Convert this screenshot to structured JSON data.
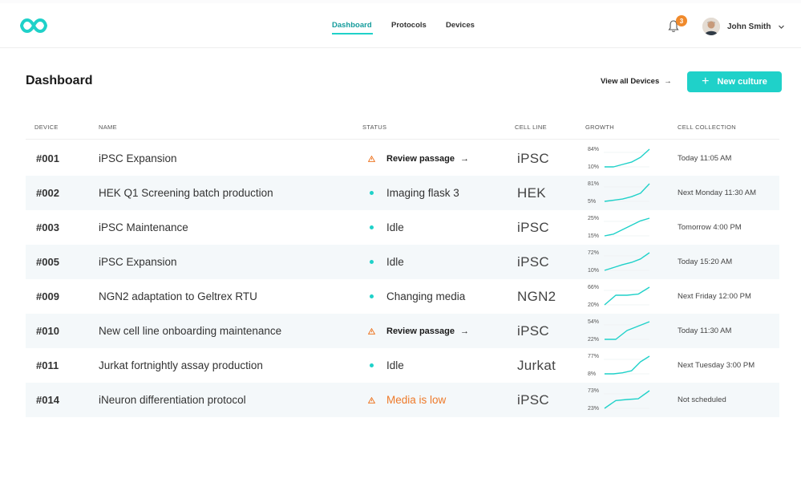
{
  "nav": {
    "items": [
      {
        "label": "Dashboard",
        "active": true
      },
      {
        "label": "Protocols",
        "active": false
      },
      {
        "label": "Devices",
        "active": false
      }
    ]
  },
  "notifications": {
    "count": "3",
    "icon": "bell-icon"
  },
  "user": {
    "name": "John Smith",
    "avatar": "avatar"
  },
  "header": {
    "title": "Dashboard",
    "view_all_label": "View all Devices",
    "view_all_arrow": "→",
    "new_culture_label": "New culture",
    "new_culture_icon": "+"
  },
  "colors": {
    "accent": "#1fd1c9",
    "accent_text": "#159c9c",
    "warning": "#ee7a2a",
    "badge": "#f08a2c",
    "row_alt": "#f4f8fa"
  },
  "table": {
    "columns": [
      "DEVICE",
      "NAME",
      "STATUS",
      "CELL LINE",
      "GROWTH",
      "CELL COLLECTION"
    ],
    "rows": [
      {
        "device": "#001",
        "name": "iPSC Expansion",
        "status": "Review passage",
        "status_type": "warning-action",
        "status_arrow": "→",
        "cell_line": "iPSC",
        "growth_high": "84%",
        "growth_low": "10%",
        "growth_series": [
          10,
          10,
          20,
          30,
          50,
          84
        ],
        "collection": "Today 11:05 AM"
      },
      {
        "device": "#002",
        "name": "HEK Q1 Screening batch production",
        "status": "Imaging flask 3",
        "status_type": "active",
        "cell_line": "HEK",
        "growth_high": "81%",
        "growth_low": "5%",
        "growth_series": [
          5,
          10,
          15,
          25,
          40,
          81
        ],
        "collection": "Next Monday 11:30 AM"
      },
      {
        "device": "#003",
        "name": "iPSC Maintenance",
        "status": "Idle",
        "status_type": "active",
        "cell_line": "iPSC",
        "growth_high": "25%",
        "growth_low": "15%",
        "growth_series": [
          15,
          16,
          18.5,
          21,
          23.5,
          25
        ],
        "collection": "Tomorrow 4:00 PM"
      },
      {
        "device": "#005",
        "name": "iPSC Expansion",
        "status": "Idle",
        "status_type": "active",
        "cell_line": "iPSC",
        "growth_high": "72%",
        "growth_low": "10%",
        "growth_series": [
          10,
          20,
          30,
          38,
          50,
          72
        ],
        "collection": "Today 15:20 AM"
      },
      {
        "device": "#009",
        "name": "NGN2 adaptation to Geltrex RTU",
        "status": "Changing media",
        "status_type": "active",
        "cell_line": "NGN2",
        "growth_high": "66%",
        "growth_low": "20%",
        "growth_series": [
          20,
          45,
          45,
          48,
          66
        ],
        "collection": "Next Friday 12:00 PM"
      },
      {
        "device": "#010",
        "name": "New cell line onboarding maintenance",
        "status": "Review passage",
        "status_type": "warning-action",
        "status_arrow": "→",
        "cell_line": "iPSC",
        "growth_high": "54%",
        "growth_low": "22%",
        "growth_series": [
          22,
          22,
          38,
          46,
          54
        ],
        "collection": "Today 11:30 AM"
      },
      {
        "device": "#011",
        "name": "Jurkat fortnightly assay production",
        "status": "Idle",
        "status_type": "active",
        "cell_line": "Jurkat",
        "growth_high": "77%",
        "growth_low": "8%",
        "growth_series": [
          8,
          8,
          12,
          20,
          55,
          77
        ],
        "collection": "Next Tuesday 3:00 PM"
      },
      {
        "device": "#014",
        "name": "iNeuron differentiation protocol",
        "status": "Media is low",
        "status_type": "warning",
        "cell_line": "iPSC",
        "growth_high": "73%",
        "growth_low": "23%",
        "growth_series": [
          23,
          45,
          48,
          50,
          73
        ],
        "collection": "Not scheduled"
      }
    ]
  }
}
